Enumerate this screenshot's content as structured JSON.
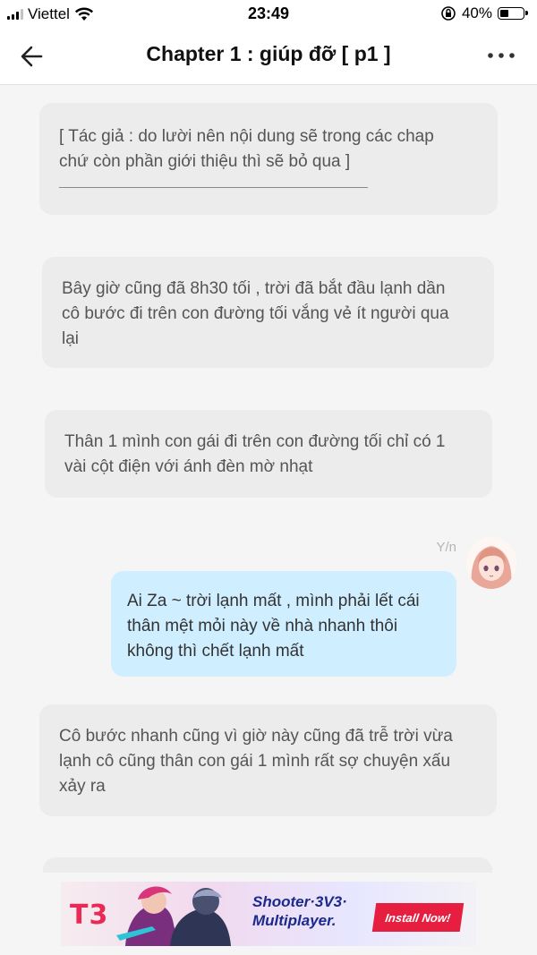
{
  "status_bar": {
    "carrier": "Viettel",
    "time": "23:49",
    "battery_percent": "40%",
    "battery_level": 0.4
  },
  "header": {
    "title": "Chapter 1 : giúp đỡ [ p1 ]",
    "back_icon": "arrow-left-icon",
    "more_icon": "more-horizontal-icon"
  },
  "messages": [
    {
      "type": "narration",
      "lines": [
        "[ Tác giả : do lười nên nội dung sẽ trong các chap",
        "chứ còn phần giới thiệu thì sẽ bỏ qua ]"
      ]
    },
    {
      "type": "narration",
      "lines": [
        "Bây giờ cũng đã 8h30 tối , trời đã bắt đầu lạnh dần",
        "cô bước đi trên con đường tối vắng vẻ ít người qua",
        "lại"
      ]
    },
    {
      "type": "narration",
      "lines": [
        "Thân 1 mình con gái đi trên con đường tối chỉ có 1",
        "vài cột điện với ánh đèn mờ nhạt"
      ]
    },
    {
      "type": "dialogue",
      "sender": "Y/n",
      "lines": [
        "Ai Za ~ trời lạnh mất , mình phải lết cái",
        "thân mệt mỏi này về nhà nhanh thôi",
        "không thì chết lạnh mất"
      ]
    },
    {
      "type": "narration",
      "lines": [
        "Cô bước nhanh cũng vì giờ này cũng đã trễ trời vừa",
        "lạnh cô cũng thân con gái 1 mình rất sợ chuyện xấu",
        "xảy ra"
      ]
    }
  ],
  "ad": {
    "brand": "T3",
    "headline": "Shooter·3V3· Multiplayer.",
    "cta": "Install Now!"
  },
  "colors": {
    "narration_bubble": "#ececec",
    "dialogue_bubble": "#cfeeff",
    "ad_button": "#e61e3f"
  }
}
